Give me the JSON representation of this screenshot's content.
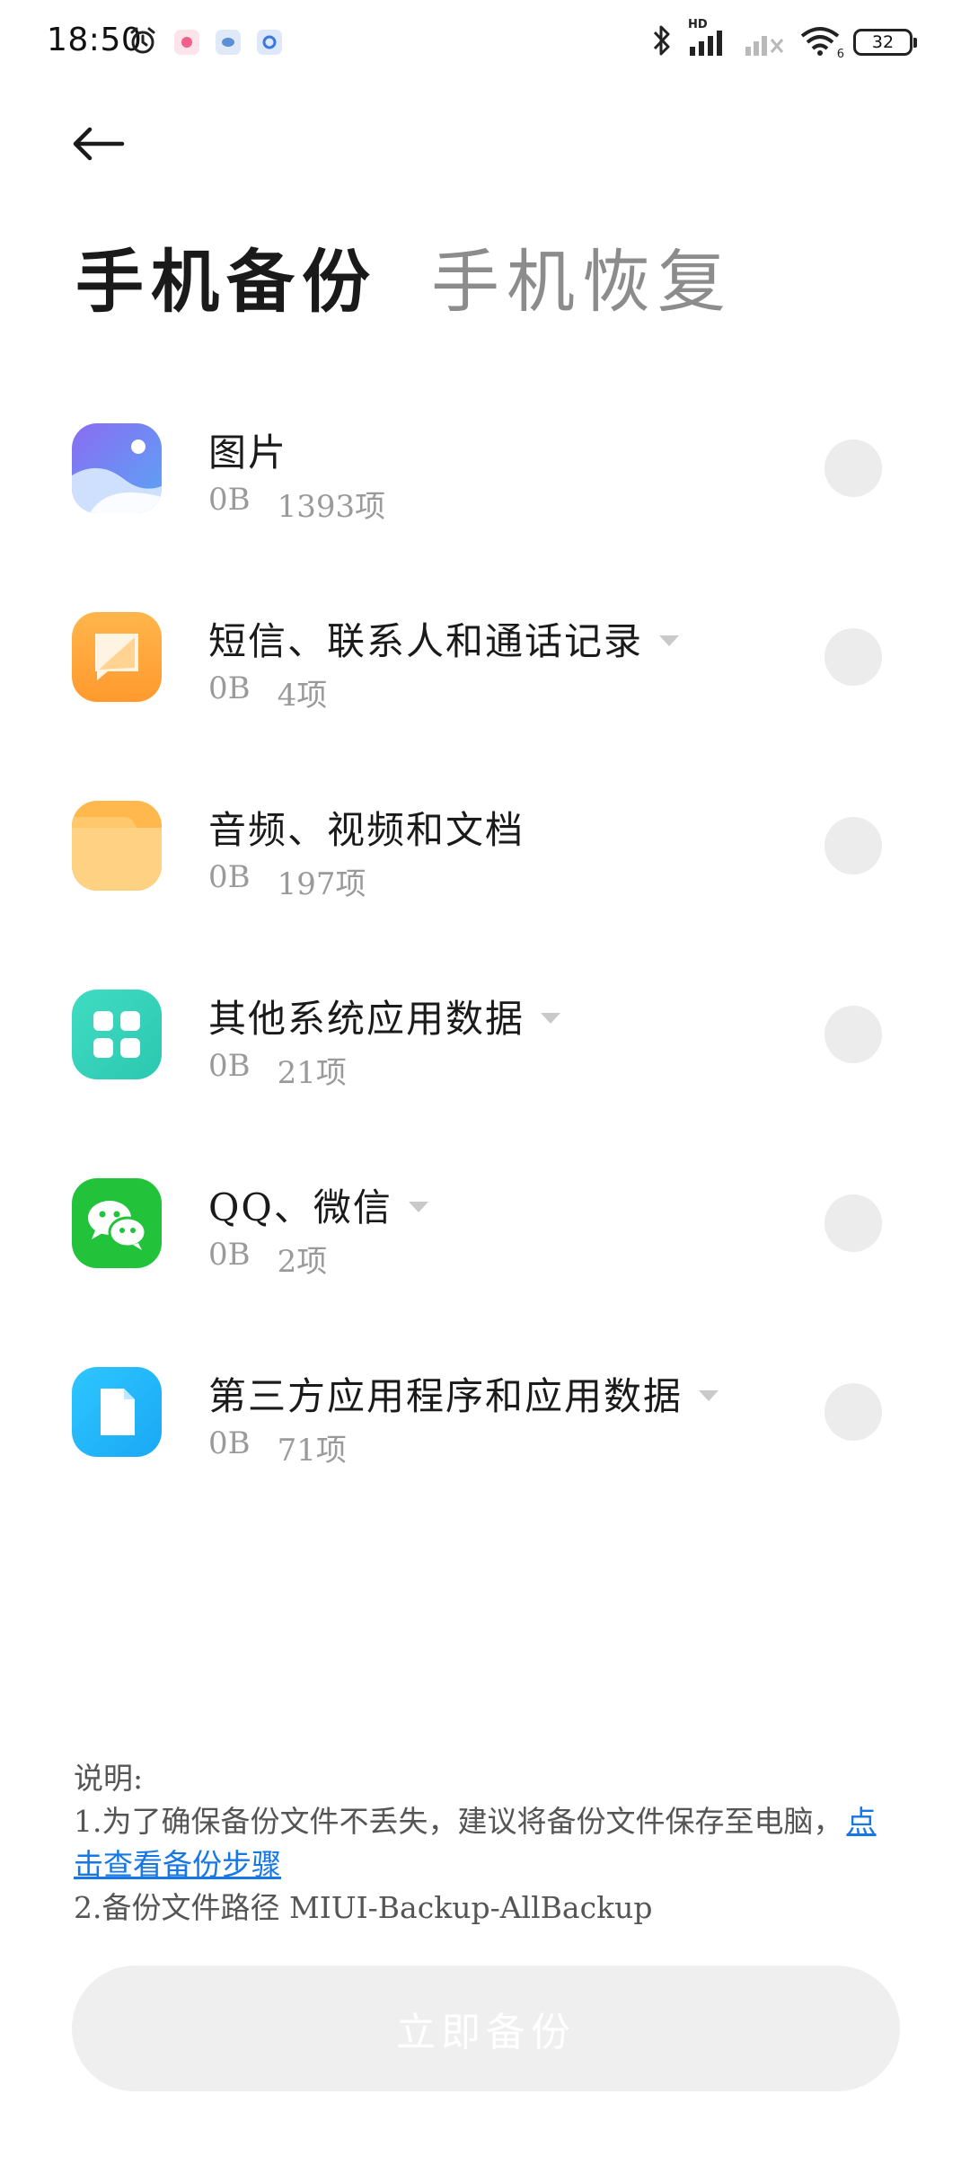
{
  "status_bar": {
    "time": "18:50",
    "battery": "32",
    "network_label": "HD",
    "wifi_label": "6"
  },
  "header": {
    "tabs": [
      {
        "label": "手机备份",
        "active": true
      },
      {
        "label": "手机恢复",
        "active": false
      }
    ]
  },
  "items": [
    {
      "title": "图片",
      "size": "0B",
      "count": "1393项",
      "has_dropdown": false,
      "icon": "gallery-icon"
    },
    {
      "title": "短信、联系人和通话记录",
      "size": "0B",
      "count": "4项",
      "has_dropdown": true,
      "icon": "messages-icon"
    },
    {
      "title": "音频、视频和文档",
      "size": "0B",
      "count": "197项",
      "has_dropdown": false,
      "icon": "folder-icon"
    },
    {
      "title": "其他系统应用数据",
      "size": "0B",
      "count": "21项",
      "has_dropdown": true,
      "icon": "system-apps-icon"
    },
    {
      "title": "QQ、微信",
      "size": "0B",
      "count": "2项",
      "has_dropdown": true,
      "icon": "wechat-icon"
    },
    {
      "title": "第三方应用程序和应用数据",
      "size": "0B",
      "count": "71项",
      "has_dropdown": true,
      "icon": "third-party-apps-icon"
    }
  ],
  "note": {
    "heading": "说明:",
    "line1": "1.为了确保备份文件不丢失，建议将备份文件保存至电脑，",
    "link": "点击查看备份步骤",
    "line2": "2.备份文件路径 MIUI-Backup-AllBackup"
  },
  "action": {
    "label": "立即备份"
  },
  "colors": {
    "link": "#1677e6",
    "inactive_tab": "#8c8c8c",
    "button_bg": "#efefef"
  }
}
